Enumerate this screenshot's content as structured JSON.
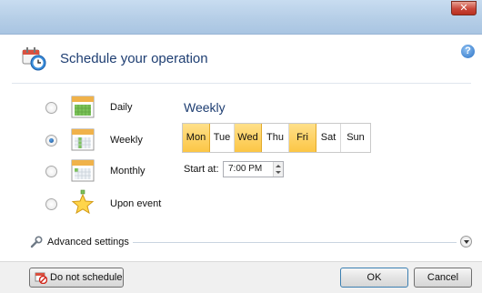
{
  "window": {
    "close_glyph": "✕"
  },
  "header": {
    "title": "Schedule your operation",
    "help_glyph": "?",
    "icon": "calendar-clock-icon"
  },
  "options": [
    {
      "label": "Daily",
      "icon": "calendar-daily-icon",
      "selected": false
    },
    {
      "label": "Weekly",
      "icon": "calendar-weekly-icon",
      "selected": true
    },
    {
      "label": "Monthly",
      "icon": "calendar-monthly-icon",
      "selected": false
    },
    {
      "label": "Upon event",
      "icon": "star-event-icon",
      "selected": false
    }
  ],
  "weekly": {
    "title": "Weekly",
    "days": [
      {
        "label": "Mon",
        "selected": true
      },
      {
        "label": "Tue",
        "selected": false
      },
      {
        "label": "Wed",
        "selected": true
      },
      {
        "label": "Thu",
        "selected": false
      },
      {
        "label": "Fri",
        "selected": true
      },
      {
        "label": "Sat",
        "selected": false
      },
      {
        "label": "Sun",
        "selected": false
      }
    ],
    "start_label": "Start at:",
    "start_time": "7:00 PM"
  },
  "advanced": {
    "label": "Advanced settings"
  },
  "footer": {
    "no_schedule_label": "Do not schedule",
    "ok_label": "OK",
    "cancel_label": "Cancel"
  },
  "colors": {
    "title_blue": "#1e3e72",
    "selected_day": "#fcc645",
    "titlebar": "#b4cde6"
  }
}
